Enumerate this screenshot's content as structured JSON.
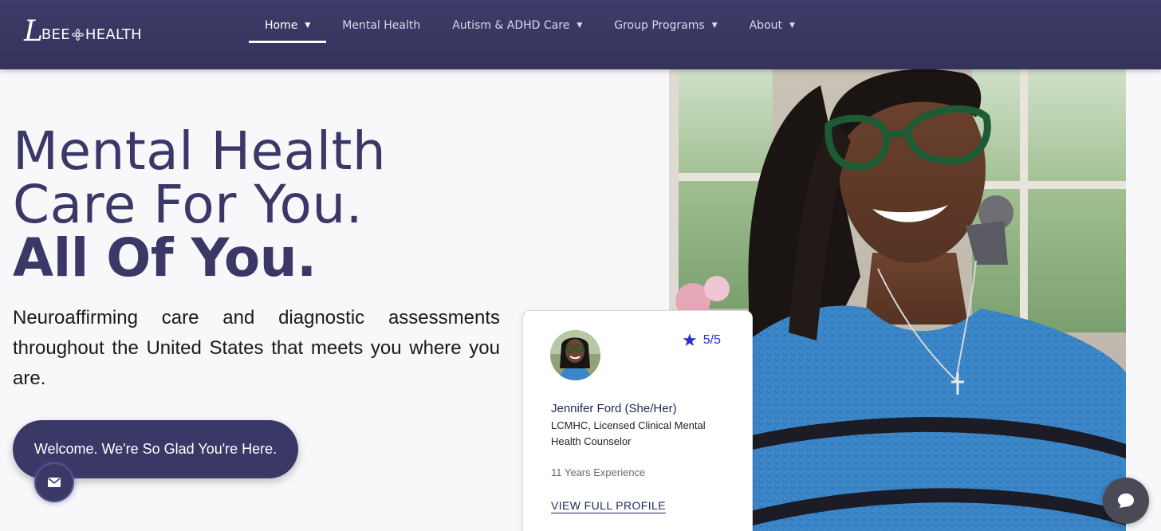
{
  "brand": {
    "script_letter": "L",
    "word_left": "BEE",
    "word_right": "HEALTH"
  },
  "nav": [
    {
      "label": "Home",
      "dropdown": true,
      "active": true
    },
    {
      "label": "Mental Health",
      "dropdown": false,
      "active": false
    },
    {
      "label": "Autism & ADHD Care",
      "dropdown": true,
      "active": false
    },
    {
      "label": "Group Programs",
      "dropdown": true,
      "active": false
    },
    {
      "label": "About",
      "dropdown": true,
      "active": false
    }
  ],
  "hero": {
    "line1": "Mental Health",
    "line2": "Care For You.",
    "line3": "All Of You.",
    "lead": "Neuroaffirming care and diagnostic assessments throughout the United States that meets you where you are.",
    "cta": "Welcome. We're So Glad You're Here."
  },
  "card": {
    "rating": "5/5",
    "name": "Jennifer Ford (She/Her)",
    "credentials": "LCMHC, Licensed Clinical Mental Health Counselor",
    "experience": "11 Years Experience",
    "link": "VIEW FULL PROFILE"
  },
  "colors": {
    "navbar": "#3e3c68",
    "brand_purple": "#3a3866",
    "star_blue": "#2a2ad8",
    "sweater_blue": "#3a86c8"
  },
  "icons": {
    "caret": "chevron-down-icon",
    "rating": "star-icon",
    "mail": "envelope-icon",
    "chat": "chat-bubble-icon"
  }
}
